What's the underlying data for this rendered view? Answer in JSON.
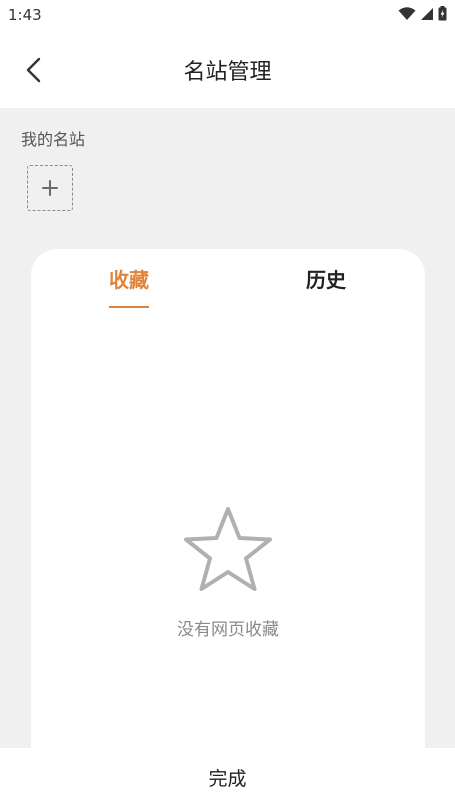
{
  "status_bar": {
    "time": "1:43"
  },
  "header": {
    "title": "名站管理",
    "back_icon": "chevron-left-icon"
  },
  "my_sites": {
    "label": "我的名站",
    "add_icon": "plus-icon"
  },
  "tabs": [
    {
      "label": "收藏",
      "active": true
    },
    {
      "label": "历史",
      "active": false
    }
  ],
  "empty_state": {
    "icon": "star-outline-icon",
    "message": "没有网页收藏"
  },
  "footer": {
    "done_label": "完成"
  },
  "colors": {
    "accent": "#e0843c",
    "background": "#f0f0f0",
    "card": "#ffffff"
  }
}
